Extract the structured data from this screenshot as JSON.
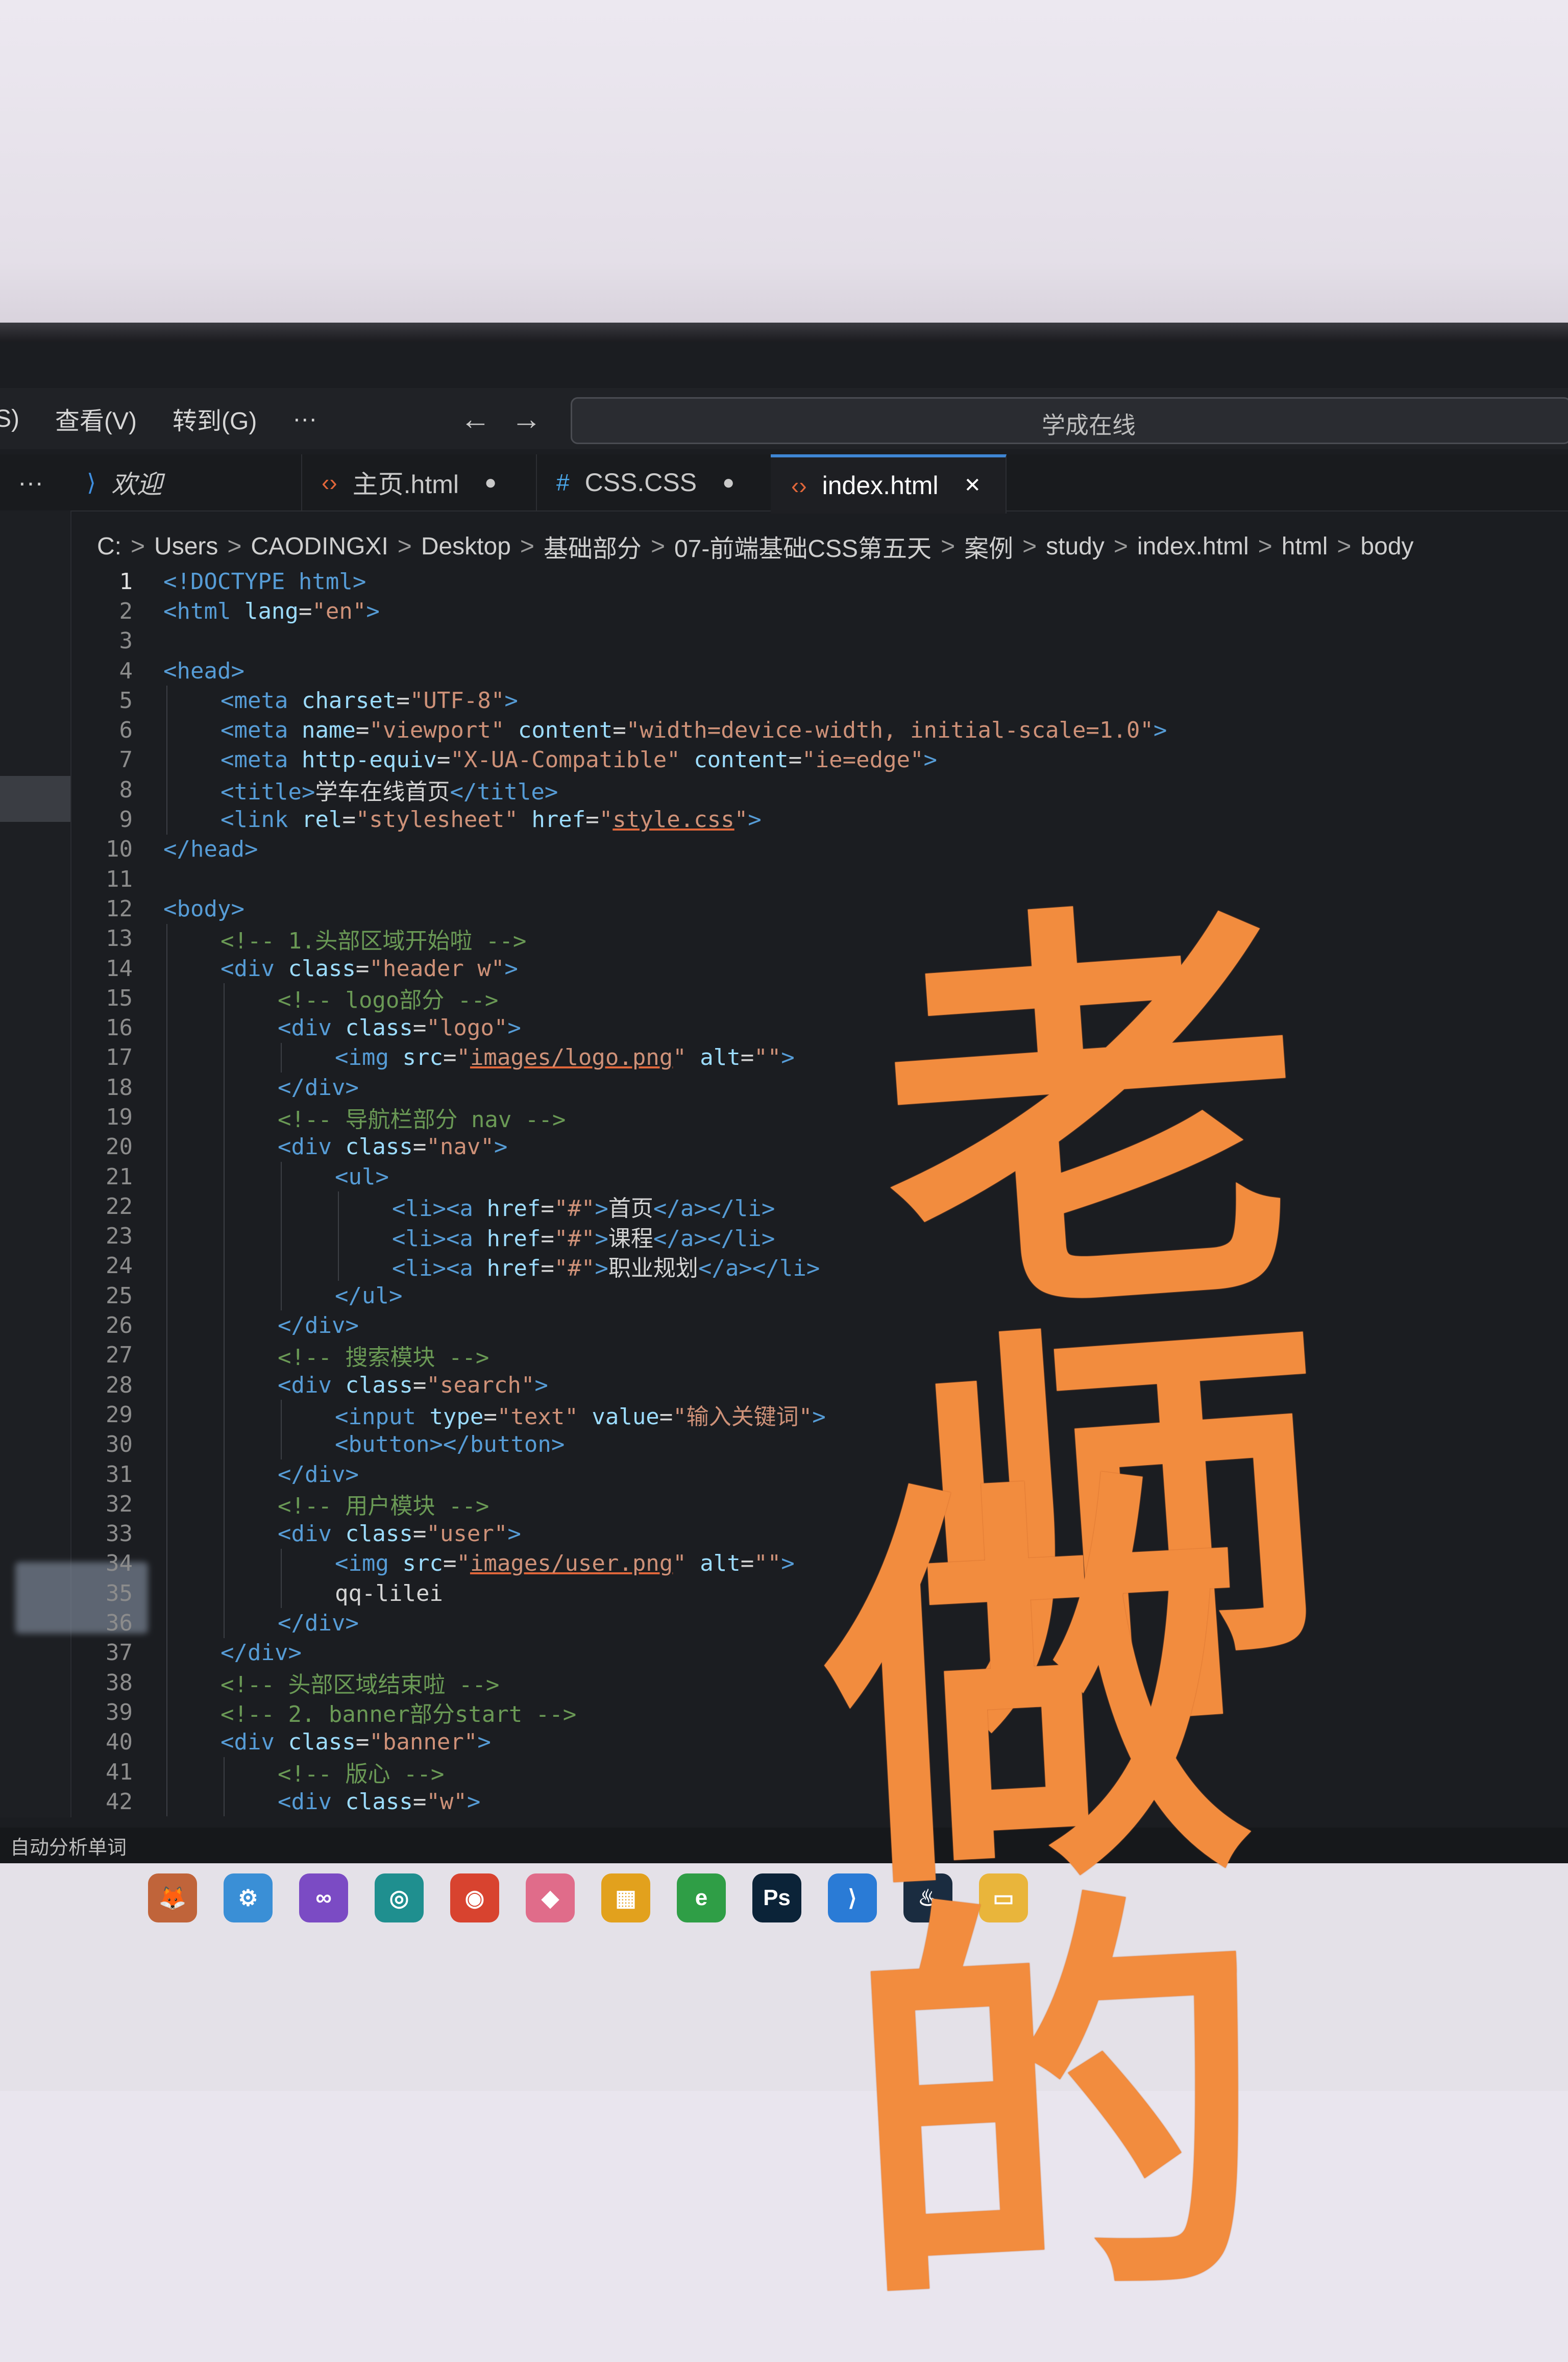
{
  "menu": {
    "partial_left": "S)",
    "view": "查看(V)",
    "goto": "转到(G)",
    "more": "···",
    "back": "←",
    "forward": "→",
    "search_text": "学成在线"
  },
  "tabs": {
    "overflow": "···",
    "items": [
      {
        "icon": "vscode-icon",
        "label": "欢迎",
        "modified": ""
      },
      {
        "icon": "html-icon",
        "label": "主页.html",
        "modified": "●"
      },
      {
        "icon": "css-icon",
        "label": "CSS.CSS",
        "modified": "●"
      },
      {
        "icon": "html-icon",
        "label": "index.html",
        "modified": "✕"
      }
    ]
  },
  "breadcrumb": [
    "C:",
    "Users",
    "CAODINGXI",
    "Desktop",
    "基础部分",
    "07-前端基础CSS第五天",
    "案例",
    "study",
    "index.html",
    "html",
    "body"
  ],
  "code_lines": [
    {
      "n": "1",
      "indent": 0,
      "tokens": [
        [
          "tag",
          "<!DOCTYPE html>"
        ]
      ]
    },
    {
      "n": "2",
      "indent": 0,
      "tokens": [
        [
          "tag",
          "<html "
        ],
        [
          "attr",
          "lang"
        ],
        [
          "code",
          "="
        ],
        [
          "str",
          "\"en\""
        ],
        [
          "tag",
          ">"
        ]
      ]
    },
    {
      "n": "3",
      "indent": 0,
      "tokens": []
    },
    {
      "n": "4",
      "indent": 0,
      "tokens": [
        [
          "tag",
          "<head>"
        ]
      ]
    },
    {
      "n": "5",
      "indent": 1,
      "tokens": [
        [
          "tag",
          "<meta "
        ],
        [
          "attr",
          "charset"
        ],
        [
          "code",
          "="
        ],
        [
          "str",
          "\"UTF-8\""
        ],
        [
          "tag",
          ">"
        ]
      ]
    },
    {
      "n": "6",
      "indent": 1,
      "tokens": [
        [
          "tag",
          "<meta "
        ],
        [
          "attr",
          "name"
        ],
        [
          "code",
          "="
        ],
        [
          "str",
          "\"viewport\" "
        ],
        [
          "attr",
          "content"
        ],
        [
          "code",
          "="
        ],
        [
          "str",
          "\"width=device-width, initial-scale=1.0\""
        ],
        [
          "tag",
          ">"
        ]
      ]
    },
    {
      "n": "7",
      "indent": 1,
      "tokens": [
        [
          "tag",
          "<meta "
        ],
        [
          "attr",
          "http-equiv"
        ],
        [
          "code",
          "="
        ],
        [
          "str",
          "\"X-UA-Compatible\" "
        ],
        [
          "attr",
          "content"
        ],
        [
          "code",
          "="
        ],
        [
          "str",
          "\"ie=edge\""
        ],
        [
          "tag",
          ">"
        ]
      ]
    },
    {
      "n": "8",
      "indent": 1,
      "tokens": [
        [
          "tag",
          "<title>"
        ],
        [
          "code",
          "学车在线首页"
        ],
        [
          "tag",
          "</title>"
        ]
      ]
    },
    {
      "n": "9",
      "indent": 1,
      "tokens": [
        [
          "tag",
          "<link "
        ],
        [
          "attr",
          "rel"
        ],
        [
          "code",
          "="
        ],
        [
          "str",
          "\"stylesheet\" "
        ],
        [
          "attr",
          "href"
        ],
        [
          "code",
          "="
        ],
        [
          "str",
          "\""
        ],
        [
          "link",
          "style.css"
        ],
        [
          "str",
          "\""
        ],
        [
          "tag",
          ">"
        ]
      ]
    },
    {
      "n": "10",
      "indent": 0,
      "tokens": [
        [
          "tag",
          "</head>"
        ]
      ]
    },
    {
      "n": "11",
      "indent": 0,
      "tokens": []
    },
    {
      "n": "12",
      "indent": 0,
      "tokens": [
        [
          "tag",
          "<body>"
        ]
      ]
    },
    {
      "n": "13",
      "indent": 1,
      "tokens": [
        [
          "cm",
          "<!-- 1.头部区域开始啦 -->"
        ]
      ]
    },
    {
      "n": "14",
      "indent": 1,
      "tokens": [
        [
          "tag",
          "<div "
        ],
        [
          "attr",
          "class"
        ],
        [
          "code",
          "="
        ],
        [
          "str",
          "\"header w\""
        ],
        [
          "tag",
          ">"
        ]
      ]
    },
    {
      "n": "15",
      "indent": 2,
      "tokens": [
        [
          "cm",
          "<!-- logo部分 -->"
        ]
      ]
    },
    {
      "n": "16",
      "indent": 2,
      "tokens": [
        [
          "tag",
          "<div "
        ],
        [
          "attr",
          "class"
        ],
        [
          "code",
          "="
        ],
        [
          "str",
          "\"logo\""
        ],
        [
          "tag",
          ">"
        ]
      ]
    },
    {
      "n": "17",
      "indent": 3,
      "tokens": [
        [
          "tag",
          "<img "
        ],
        [
          "attr",
          "src"
        ],
        [
          "code",
          "="
        ],
        [
          "str",
          "\""
        ],
        [
          "link",
          "images/logo.png"
        ],
        [
          "str",
          "\" "
        ],
        [
          "attr",
          "alt"
        ],
        [
          "code",
          "="
        ],
        [
          "str",
          "\"\""
        ],
        [
          "tag",
          ">"
        ]
      ]
    },
    {
      "n": "18",
      "indent": 2,
      "tokens": [
        [
          "tag",
          "</div>"
        ]
      ]
    },
    {
      "n": "19",
      "indent": 2,
      "tokens": [
        [
          "cm",
          "<!-- 导航栏部分 nav -->"
        ]
      ]
    },
    {
      "n": "20",
      "indent": 2,
      "tokens": [
        [
          "tag",
          "<div "
        ],
        [
          "attr",
          "class"
        ],
        [
          "code",
          "="
        ],
        [
          "str",
          "\"nav\""
        ],
        [
          "tag",
          ">"
        ]
      ]
    },
    {
      "n": "21",
      "indent": 3,
      "tokens": [
        [
          "tag",
          "<ul>"
        ]
      ]
    },
    {
      "n": "22",
      "indent": 4,
      "tokens": [
        [
          "tag",
          "<li><a "
        ],
        [
          "attr",
          "href"
        ],
        [
          "code",
          "="
        ],
        [
          "str",
          "\"#\""
        ],
        [
          "tag",
          ">"
        ],
        [
          "code",
          "首页"
        ],
        [
          "tag",
          "</a></li>"
        ]
      ]
    },
    {
      "n": "23",
      "indent": 4,
      "tokens": [
        [
          "tag",
          "<li><a "
        ],
        [
          "attr",
          "href"
        ],
        [
          "code",
          "="
        ],
        [
          "str",
          "\"#\""
        ],
        [
          "tag",
          ">"
        ],
        [
          "code",
          "课程"
        ],
        [
          "tag",
          "</a></li>"
        ]
      ]
    },
    {
      "n": "24",
      "indent": 4,
      "tokens": [
        [
          "tag",
          "<li><a "
        ],
        [
          "attr",
          "href"
        ],
        [
          "code",
          "="
        ],
        [
          "str",
          "\"#\""
        ],
        [
          "tag",
          ">"
        ],
        [
          "code",
          "职业规划"
        ],
        [
          "tag",
          "</a></li>"
        ]
      ]
    },
    {
      "n": "25",
      "indent": 3,
      "tokens": [
        [
          "tag",
          "</ul>"
        ]
      ]
    },
    {
      "n": "26",
      "indent": 2,
      "tokens": [
        [
          "tag",
          "</div>"
        ]
      ]
    },
    {
      "n": "27",
      "indent": 2,
      "tokens": [
        [
          "cm",
          "<!-- 搜索模块 -->"
        ]
      ]
    },
    {
      "n": "28",
      "indent": 2,
      "tokens": [
        [
          "tag",
          "<div "
        ],
        [
          "attr",
          "class"
        ],
        [
          "code",
          "="
        ],
        [
          "str",
          "\"search\""
        ],
        [
          "tag",
          ">"
        ]
      ]
    },
    {
      "n": "29",
      "indent": 3,
      "tokens": [
        [
          "tag",
          "<input "
        ],
        [
          "attr",
          "type"
        ],
        [
          "code",
          "="
        ],
        [
          "str",
          "\"text\" "
        ],
        [
          "attr",
          "value"
        ],
        [
          "code",
          "="
        ],
        [
          "str",
          "\"输入关键词\""
        ],
        [
          "tag",
          ">"
        ]
      ]
    },
    {
      "n": "30",
      "indent": 3,
      "tokens": [
        [
          "tag",
          "<button></button>"
        ]
      ]
    },
    {
      "n": "31",
      "indent": 2,
      "tokens": [
        [
          "tag",
          "</div>"
        ]
      ]
    },
    {
      "n": "32",
      "indent": 2,
      "tokens": [
        [
          "cm",
          "<!-- 用户模块 -->"
        ]
      ]
    },
    {
      "n": "33",
      "indent": 2,
      "tokens": [
        [
          "tag",
          "<div "
        ],
        [
          "attr",
          "class"
        ],
        [
          "code",
          "="
        ],
        [
          "str",
          "\"user\""
        ],
        [
          "tag",
          ">"
        ]
      ]
    },
    {
      "n": "34",
      "indent": 3,
      "tokens": [
        [
          "tag",
          "<img "
        ],
        [
          "attr",
          "src"
        ],
        [
          "code",
          "="
        ],
        [
          "str",
          "\""
        ],
        [
          "link",
          "images/user.png"
        ],
        [
          "str",
          "\" "
        ],
        [
          "attr",
          "alt"
        ],
        [
          "code",
          "="
        ],
        [
          "str",
          "\"\""
        ],
        [
          "tag",
          ">"
        ]
      ]
    },
    {
      "n": "35",
      "indent": 3,
      "tokens": [
        [
          "code",
          "qq-lilei"
        ]
      ]
    },
    {
      "n": "36",
      "indent": 2,
      "tokens": [
        [
          "tag",
          "</div>"
        ]
      ]
    },
    {
      "n": "37",
      "indent": 1,
      "tokens": [
        [
          "tag",
          "</div>"
        ]
      ]
    },
    {
      "n": "38",
      "indent": 1,
      "tokens": [
        [
          "cm",
          "<!-- 头部区域结束啦 -->"
        ]
      ]
    },
    {
      "n": "39",
      "indent": 1,
      "tokens": [
        [
          "cm",
          "<!-- 2. banner部分start -->"
        ]
      ]
    },
    {
      "n": "40",
      "indent": 1,
      "tokens": [
        [
          "tag",
          "<div "
        ],
        [
          "attr",
          "class"
        ],
        [
          "code",
          "="
        ],
        [
          "str",
          "\"banner\""
        ],
        [
          "tag",
          ">"
        ]
      ]
    },
    {
      "n": "41",
      "indent": 2,
      "tokens": [
        [
          "cm",
          "<!-- 版心 -->"
        ]
      ]
    },
    {
      "n": "42",
      "indent": 2,
      "tokens": [
        [
          "tag",
          "<div "
        ],
        [
          "attr",
          "class"
        ],
        [
          "code",
          "="
        ],
        [
          "str",
          "\"w\""
        ],
        [
          "tag",
          ">"
        ]
      ]
    }
  ],
  "status_text": "自动分析单词",
  "taskbar": [
    {
      "name": "app-icon",
      "glyph": "🦊",
      "color": "#c0643a"
    },
    {
      "name": "settings-icon",
      "glyph": "⚙",
      "color": "#3a8fd6"
    },
    {
      "name": "visual-studio-icon",
      "glyph": "∞",
      "color": "#7b4bc4"
    },
    {
      "name": "circle-app-icon",
      "glyph": "◎",
      "color": "#1f8f8f"
    },
    {
      "name": "chrome-icon",
      "glyph": "◉",
      "color": "#d8432f"
    },
    {
      "name": "diamond-app-icon",
      "glyph": "◆",
      "color": "#e06c8a"
    },
    {
      "name": "grid-app-icon",
      "glyph": "▦",
      "color": "#e2a11d"
    },
    {
      "name": "ie-icon",
      "glyph": "e",
      "color": "#2f9e46"
    },
    {
      "name": "photoshop-icon",
      "glyph": "Ps",
      "color": "#0b2338"
    },
    {
      "name": "vscode-icon",
      "glyph": "⟩",
      "color": "#2a7bd6"
    },
    {
      "name": "steam-icon",
      "glyph": "♨",
      "color": "#1a2c40"
    },
    {
      "name": "folder-icon",
      "glyph": "▭",
      "color": "#e9b53b"
    }
  ],
  "overlay": {
    "line1": "老师",
    "line2": "做的"
  }
}
